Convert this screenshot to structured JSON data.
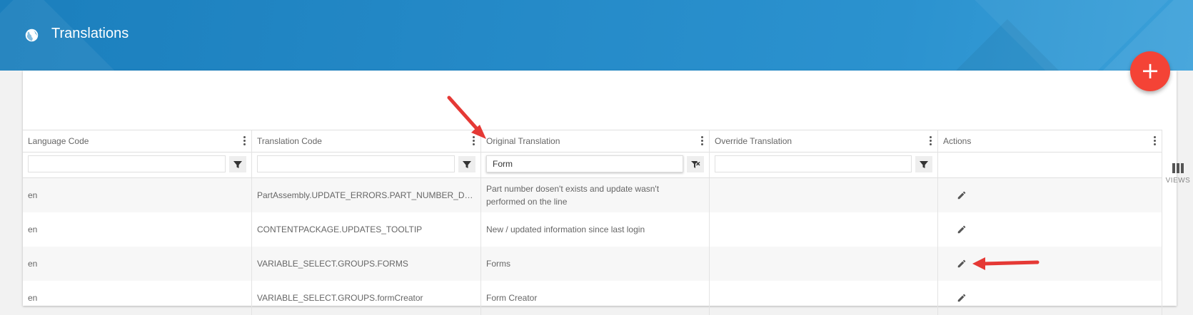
{
  "header": {
    "title": "Translations",
    "icon": "globe-icon",
    "accent_color": "#2489c7"
  },
  "toolbar": {
    "add_button_label": "+",
    "add_button_color": "#f44336",
    "views_label": "VIEWS"
  },
  "table": {
    "columns": [
      {
        "label": "Language Code",
        "filter_value": ""
      },
      {
        "label": "Translation Code",
        "filter_value": ""
      },
      {
        "label": "Original Translation",
        "filter_value": "Form",
        "filter_active": true
      },
      {
        "label": "Override Translation",
        "filter_value": ""
      },
      {
        "label": "Actions"
      }
    ],
    "rows": [
      {
        "language": "en",
        "code": "PartAssembly.UPDATE_ERRORS.PART_NUMBER_DO...",
        "original": "Part number dosen't exists and update wasn't performed on the line",
        "override": ""
      },
      {
        "language": "en",
        "code": "CONTENTPACKAGE.UPDATES_TOOLTIP",
        "original": "New / updated information since last login",
        "override": ""
      },
      {
        "language": "en",
        "code": "VARIABLE_SELECT.GROUPS.FORMS",
        "original": "Forms",
        "override": ""
      },
      {
        "language": "en",
        "code": "VARIABLE_SELECT.GROUPS.formCreator",
        "original": "Form Creator",
        "override": ""
      }
    ]
  },
  "annotations": {
    "arrow_color": "#e53935"
  }
}
